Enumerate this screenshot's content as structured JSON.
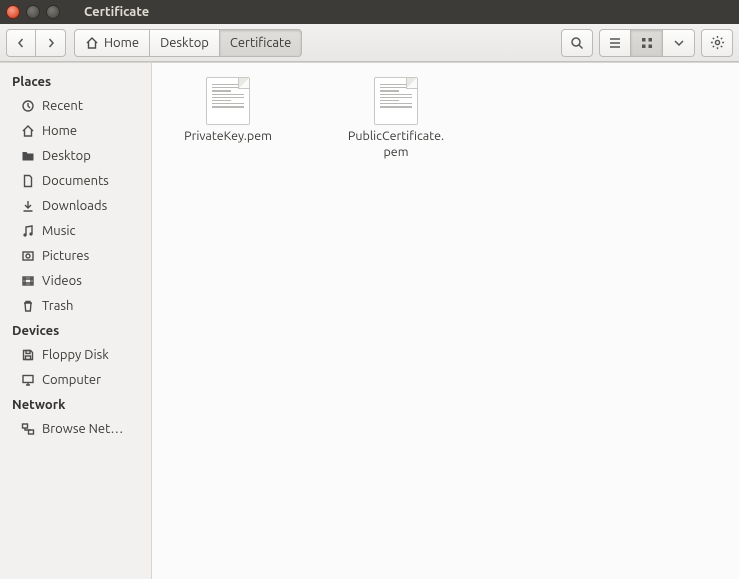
{
  "window": {
    "title": "Certificate"
  },
  "toolbar": {
    "home_label": "Home",
    "search_tooltip": "Search",
    "list_view": "List",
    "icon_view": "Icons",
    "more_view": "More",
    "gear": "Settings"
  },
  "breadcrumbs": [
    {
      "label": "Home",
      "icon": "home",
      "active": false
    },
    {
      "label": "Desktop",
      "icon": null,
      "active": false
    },
    {
      "label": "Certificate",
      "icon": null,
      "active": true
    }
  ],
  "sidebar": {
    "sections": [
      {
        "header": "Places",
        "items": [
          {
            "icon": "recent",
            "label": "Recent"
          },
          {
            "icon": "home",
            "label": "Home"
          },
          {
            "icon": "desktop",
            "label": "Desktop"
          },
          {
            "icon": "doc",
            "label": "Documents"
          },
          {
            "icon": "download",
            "label": "Downloads"
          },
          {
            "icon": "music",
            "label": "Music"
          },
          {
            "icon": "pictures",
            "label": "Pictures"
          },
          {
            "icon": "videos",
            "label": "Videos"
          },
          {
            "icon": "trash",
            "label": "Trash"
          }
        ]
      },
      {
        "header": "Devices",
        "items": [
          {
            "icon": "floppy",
            "label": "Floppy Disk"
          },
          {
            "icon": "computer",
            "label": "Computer"
          }
        ]
      },
      {
        "header": "Network",
        "items": [
          {
            "icon": "network",
            "label": "Browse Net…"
          }
        ]
      }
    ]
  },
  "files": [
    {
      "name": "PrivateKey.pem"
    },
    {
      "name": "PublicCertificate.pem"
    }
  ]
}
